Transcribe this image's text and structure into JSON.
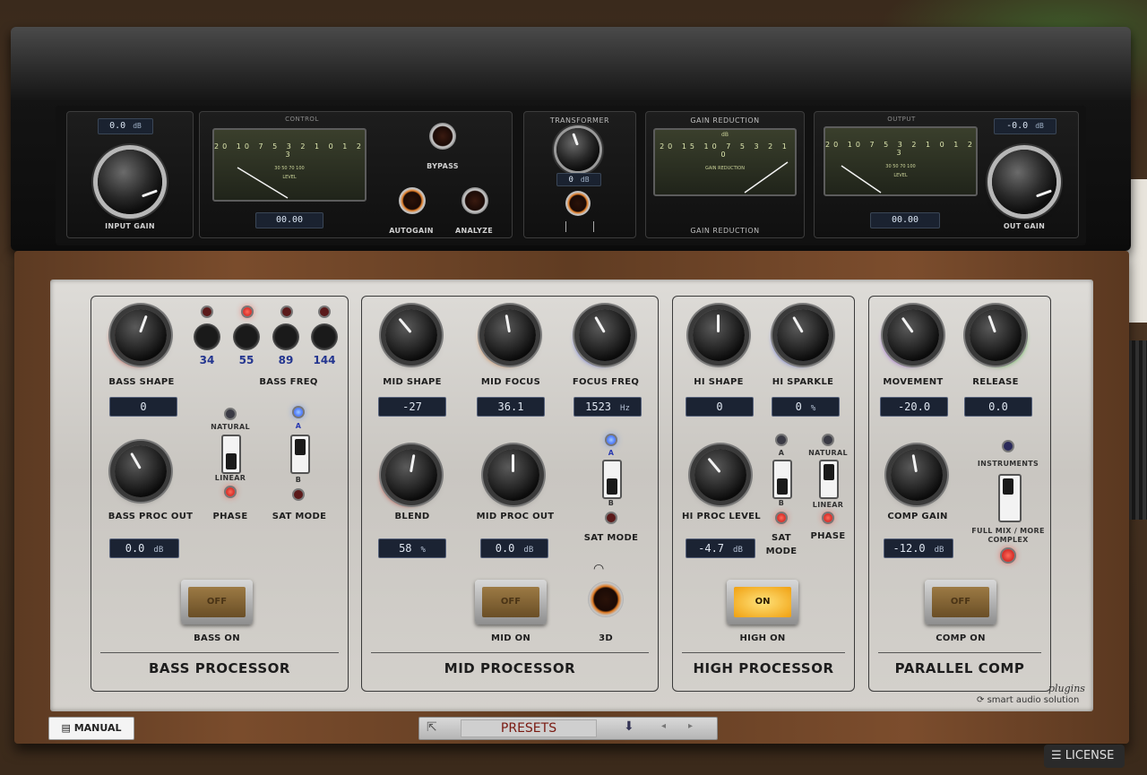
{
  "rack": {
    "input_gain": {
      "value": "0.0",
      "unit": "dB",
      "label": "INPUT GAIN"
    },
    "control": {
      "title": "CONTROL",
      "meter_scale": "20 10 7 5 3 2 1 0 1 2 3",
      "meter_sub": "30 50 70 100",
      "meter_label": "LEVEL",
      "readout": "00.00",
      "bypass_label": "BYPASS",
      "autogain_label": "AUTOGAIN",
      "analyze_label": "ANALYZE"
    },
    "transformer": {
      "title": "TRANSFORMER",
      "value": "0",
      "unit": "dB"
    },
    "gain_reduction": {
      "title": "GAIN REDUCTION",
      "unit": "dB",
      "meter_scale": "20 15 10 7 5 3 2 1 0",
      "meter_label": "GAIN REDUCTION",
      "bottom_label": "GAIN REDUCTION"
    },
    "output": {
      "title": "OUTPUT",
      "value": "-0.0",
      "unit": "dB",
      "readout": "00.00",
      "label": "OUT GAIN",
      "meter_scale": "20 10 7 5 3 2 1 0 1 2 3",
      "meter_sub": "30 50 70 100",
      "meter_label": "LEVEL"
    }
  },
  "bass": {
    "title": "BASS PROCESSOR",
    "shape_label": "BASS SHAPE",
    "shape_value": "0",
    "freq_label": "BASS FREQ",
    "freqs": [
      "34",
      "55",
      "89",
      "144"
    ],
    "proc_out_label": "BASS PROC OUT",
    "proc_out_value": "0.0",
    "proc_out_unit": "dB",
    "phase_label": "PHASE",
    "phase_natural": "NATURAL",
    "phase_linear": "LINEAR",
    "sat_label": "SAT MODE",
    "sat_a": "A",
    "sat_b": "B",
    "on_label": "BASS ON",
    "on_state": "OFF"
  },
  "mid": {
    "title": "MID PROCESSOR",
    "shape_label": "MID SHAPE",
    "shape_value": "-27",
    "focus_label": "MID FOCUS",
    "focus_value": "36.1",
    "freq_label": "FOCUS FREQ",
    "freq_value": "1523",
    "freq_unit": "Hz",
    "blend_label": "BLEND",
    "blend_value": "58",
    "blend_unit": "%",
    "proc_out_label": "MID PROC OUT",
    "proc_out_value": "0.0",
    "proc_out_unit": "dB",
    "sat_label": "SAT MODE",
    "sat_a": "A",
    "sat_b": "B",
    "on_label": "MID ON",
    "on_state": "OFF",
    "threed_label": "3D"
  },
  "high": {
    "title": "HIGH PROCESSOR",
    "shape_label": "HI SHAPE",
    "shape_value": "0",
    "sparkle_label": "HI SPARKLE",
    "sparkle_value": "0",
    "sparkle_unit": "%",
    "level_label": "HI PROC LEVEL",
    "level_value": "-4.7",
    "level_unit": "dB",
    "sat_label": "SAT MODE",
    "sat_a": "A",
    "sat_b": "B",
    "phase_label": "PHASE",
    "phase_natural": "NATURAL",
    "phase_linear": "LINEAR",
    "on_label": "HIGH ON",
    "on_state": "ON"
  },
  "comp": {
    "title": "PARALLEL COMP",
    "movement_label": "MOVEMENT",
    "movement_value": "-20.0",
    "release_label": "RELEASE",
    "release_value": "0.0",
    "gain_label": "COMP GAIN",
    "gain_value": "-12.0",
    "gain_unit": "dB",
    "instruments_label": "INSTRUMENTS",
    "fullmix_label": "FULL MIX / MORE COMPLEX",
    "on_label": "COMP ON",
    "on_state": "OFF"
  },
  "brand": {
    "name": "smart audio solution",
    "tag": "plugins"
  },
  "footer": {
    "manual": "MANUAL",
    "presets": "PRESETS",
    "license": "LICENSE"
  },
  "colors": {
    "accent_blue": "#3070ff",
    "led_red": "#ff3020",
    "ring_orange": "#f07a20"
  }
}
